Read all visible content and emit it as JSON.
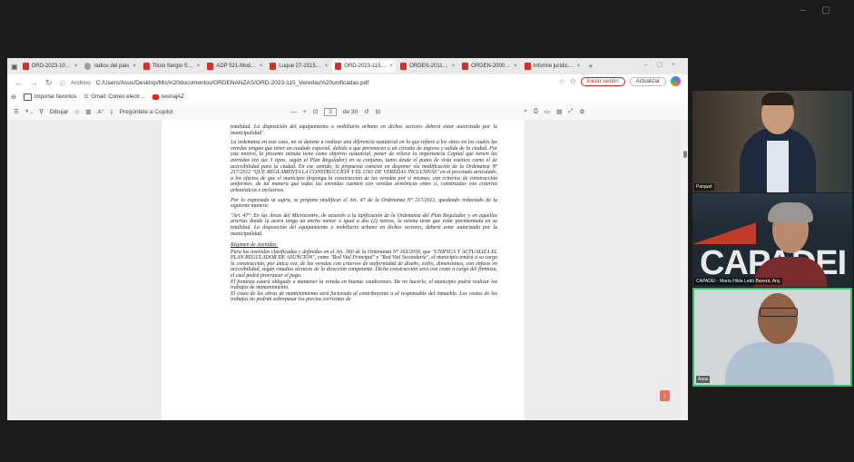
{
  "browser": {
    "tabs": [
      {
        "label": "ORD-2023-10…",
        "icon": "pdf-icon"
      },
      {
        "label": "radios del pais",
        "icon": "web-icon"
      },
      {
        "label": "Titulo Sergio S…",
        "icon": "pdf-icon"
      },
      {
        "label": "ADP 521-Mod…",
        "icon": "pdf-icon"
      },
      {
        "label": "Luque 27-1515…",
        "icon": "pdf-icon"
      },
      {
        "label": "ORD-2023-115…",
        "icon": "pdf-icon",
        "active": true
      },
      {
        "label": "ORDEN-2011…",
        "icon": "pdf-icon"
      },
      {
        "label": "ORDEN-2000…",
        "icon": "pdf-icon"
      },
      {
        "label": "Informe jurídic…",
        "icon": "pdf-icon"
      }
    ],
    "address": {
      "prefix": "Archivo",
      "url": "C:/Users/Asus/Desktop/Mis%20documentos/ORDENANZAS/ORD-2023-115_Veredas%20unificadas.pdf"
    },
    "sign_in": "Iniciar sesión",
    "update": "Actualizar",
    "favorites": [
      {
        "label": "Importar favoritos",
        "icon": "folder-icon"
      },
      {
        "label": "Gmail: Correo electr…",
        "icon": "google-icon"
      },
      {
        "label": "tesinajAZ",
        "icon": "youtube-icon"
      }
    ]
  },
  "pdf_toolbar": {
    "draw": "Dibujar",
    "copilot": "Pregúntele a Copilot",
    "page_current": "3",
    "page_total": "de 30"
  },
  "document": {
    "paragraphs": [
      "totalidad. La disposición del equipamiento o mobiliario urbano en dichos sectores deberá estar autorizado por la municipalidad\".",
      "La ordenanza en este caso, no se detiene a realizar una diferencia sustancial en lo que refiere a los sitios en los cuales las veredas tengan que tener un cuidado especial, debido a que pertenecen a un circuito de ingreso y salida de la ciudad. Por este motivo, la presente minuta tiene como objetivo sustancial, poner de relieve la importancia Capital que tienen las avenidas (en sus 3 tipos, según el Plan Regulador) en su conjunto, tanto desde el punto de vista estético como el de accesibilidad para la ciudad. En ese sentido, la propuesta consiste en disponer vía modificación de la Ordenanza Nº 217/2012 \"QUE REGLAMENTA LA CONSTRUCCIÓN Y EL USO DE VEREDAS INCLUSIVAS\" en el precitado articulado, a los efectos de que el municipio disponga la construcción de las veredas por sí mismas, con criterios de construcción uniformes, de tal manera que todas las avenidas cuenten con veredas armónicas entre sí, construidas con criterios urbanísticos e inclusivos.",
      "Por lo expresado ut supra, se propone modificar el Art. 47 de la Ordenanza Nº 217/2012, quedando redactado de la siguiente manera:",
      "\"Art. 47º: En las Áreas del Microcentro, de acuerdo a la tipificación de la Ordenanza del Plan Regulador, y en aquellas arterias donde la acera tenga un ancho menor o igual a dos (2) metros, la misma tiene que estar pavimentada en su totalidad. La disposición del equipamiento o mobiliario urbano en dichos sectores, deberá estar autorizado por la municipalidad."
    ],
    "heading": "Régimen de Avenidas:",
    "paragraphs2": [
      "Para las avenidas clasificadas y definidas en el Art. 360 de la Ordenanza Nº 163/2018, que \"UNIFICA Y ACTUALIZA EL PLAN REGULADOR DE ASUNCIÓN\", como \"Red Vial Principal\" y \"Red Vial Secundaria\", el municipio tendrá a su cargo la construcción, por única vez, de las veredas con criterios de uniformidad de diseño, estilo, dimensiones, con énfasis en accesibilidad, según estudios técnicos de la dirección competente. Dicha construcción será con costo a cargo del frentista, el cual podrá prorratear el pago.",
      "El frentista estará obligado a mantener la vereda en buenas condiciones. De no hacerlo, el municipio podrá realizar los trabajos de mantenimiento.",
      "El costo de las obras de mantenimiento será facturado al contribuyente o al responsable del inmueble. Los costos de los trabajos no podrán sobrepasar los precios corrientes de"
    ]
  },
  "participants": [
    {
      "label": "Parquet"
    },
    {
      "label": "CAPADEI - María Hilda Ledó Bavera, Arq."
    },
    {
      "label": "Asus"
    }
  ],
  "capadei_logo": "CAPADEI",
  "colors": {
    "active_speaker_border": "#2ec66d",
    "pdf_red": "#d93025"
  }
}
